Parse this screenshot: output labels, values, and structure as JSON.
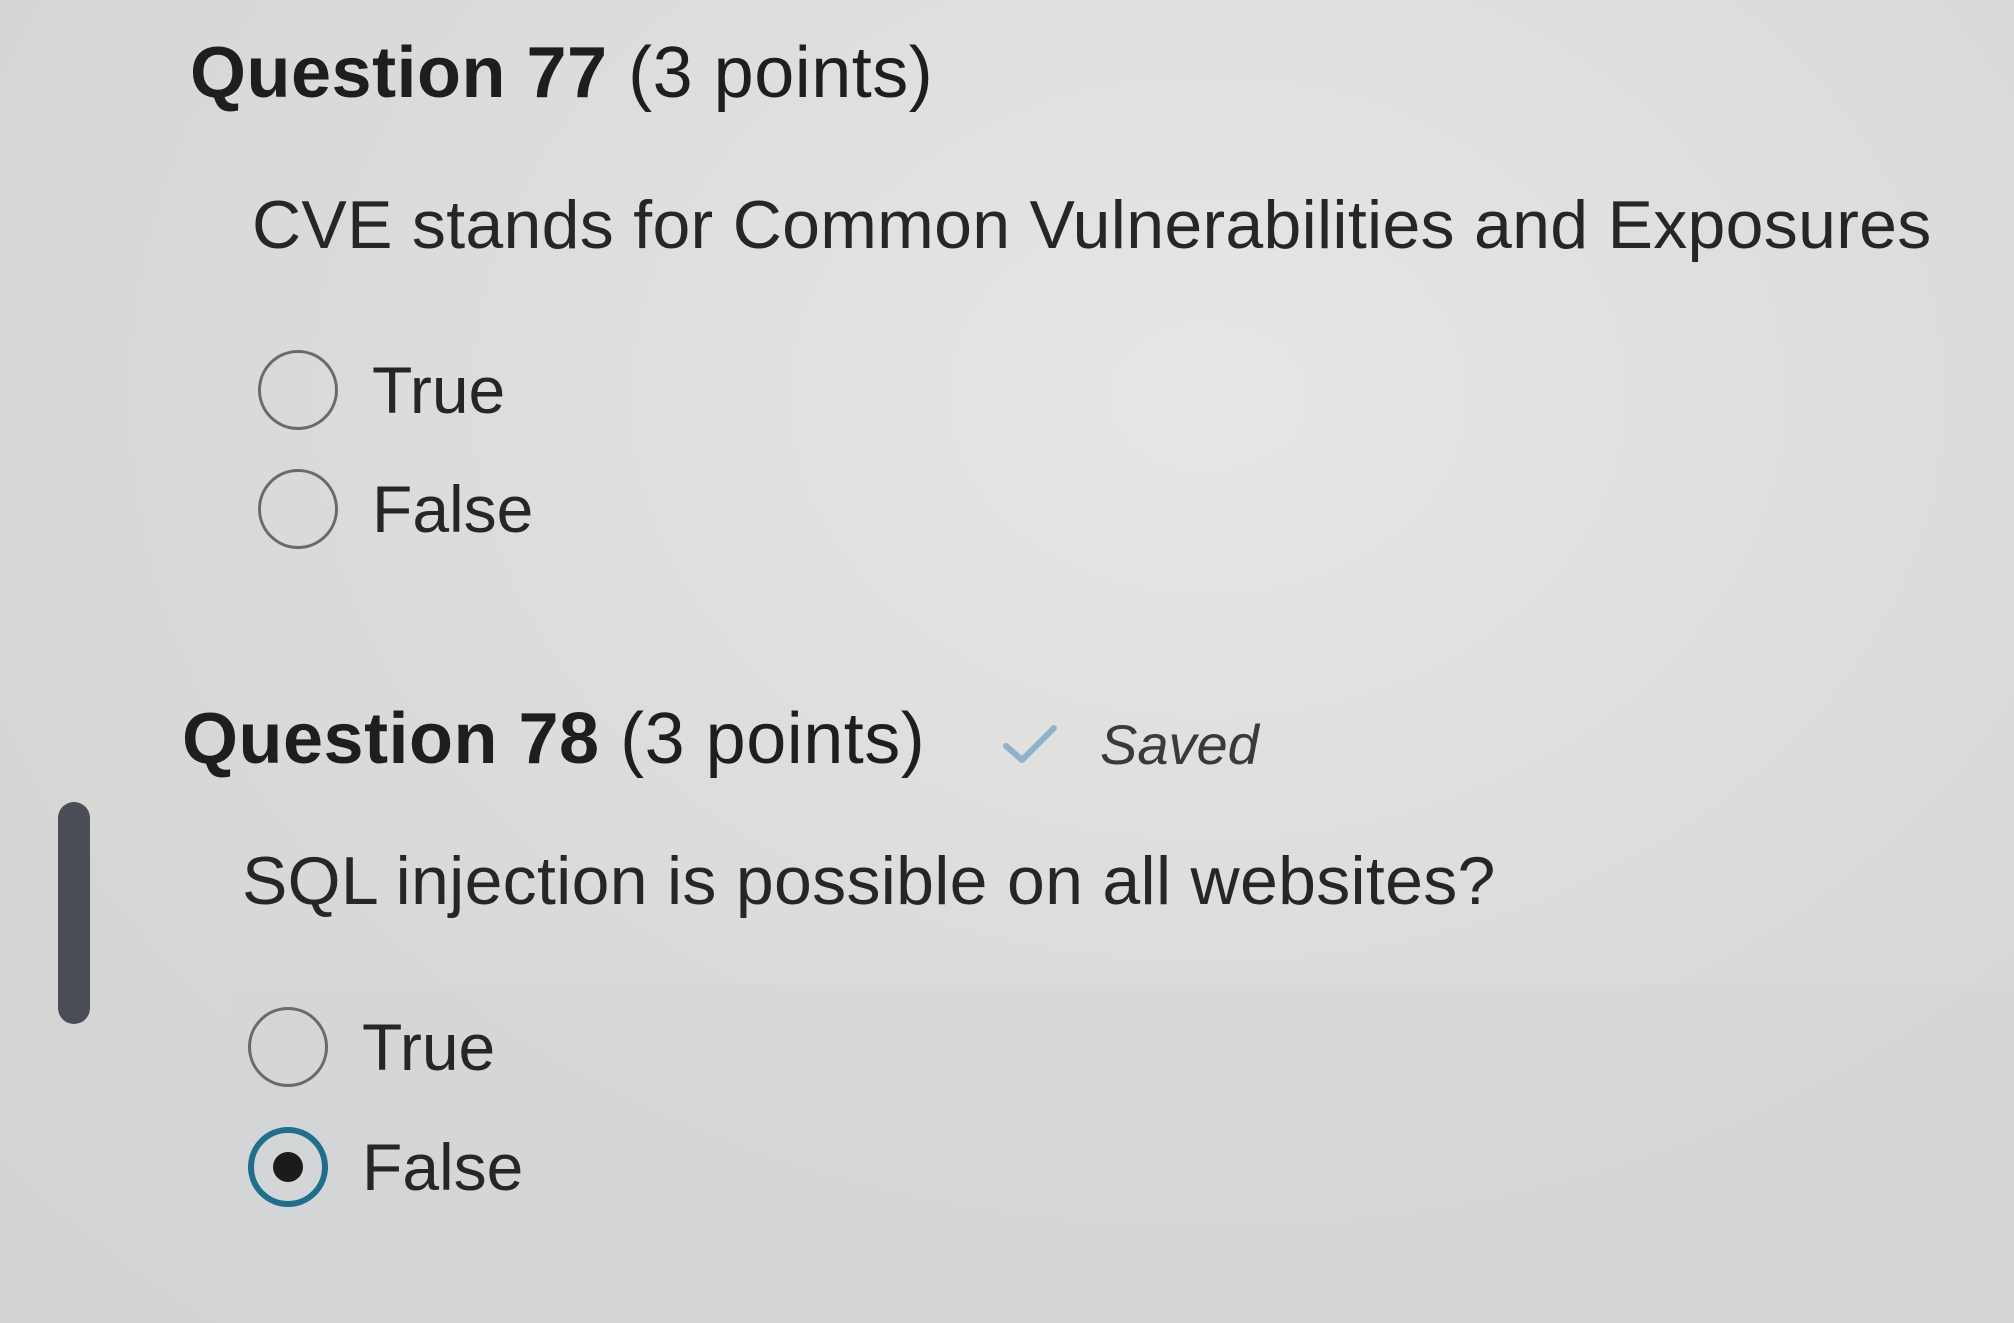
{
  "questions": [
    {
      "title": "Question 77",
      "points": "(3 points)",
      "text": "CVE stands for Common Vulnerabilities and Exposures",
      "options": [
        {
          "label": "True",
          "selected": false
        },
        {
          "label": "False",
          "selected": false
        }
      ]
    },
    {
      "title": "Question 78",
      "points": "(3 points)",
      "status": "Saved",
      "text": "SQL injection is possible on all websites?",
      "options": [
        {
          "label": "True",
          "selected": false
        },
        {
          "label": "False",
          "selected": true
        }
      ]
    }
  ],
  "icons": {
    "saved": "check-icon"
  },
  "colors": {
    "selected_ring": "#1f6f8b",
    "current_question_marker": "#4a4d55"
  }
}
